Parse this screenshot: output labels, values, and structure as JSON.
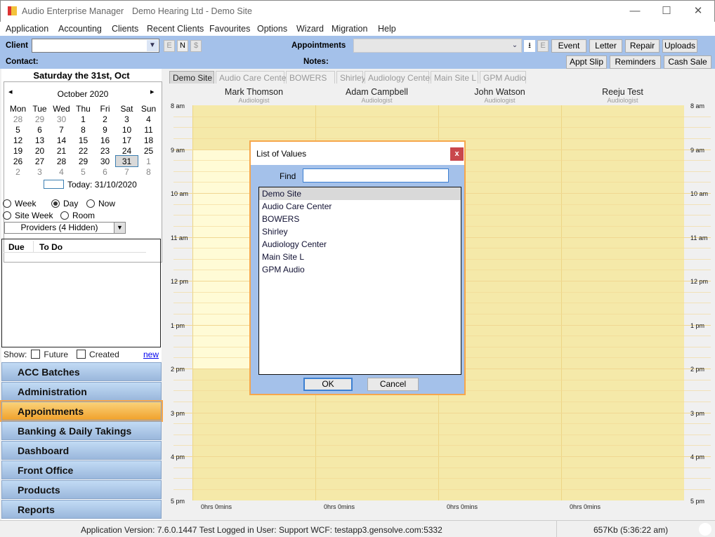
{
  "window": {
    "app_title": "Audio Enterprise Manager",
    "subtitle": "Demo Hearing Ltd - Demo Site",
    "minimize": "—",
    "maximize": "☐",
    "close": "✕"
  },
  "menu": [
    "Application",
    "Accounting",
    "Clients",
    "Recent Clients",
    "Favourites",
    "Options",
    "Wizard",
    "Migration",
    "Help"
  ],
  "toolbar": {
    "client_label": "Client",
    "client_value": "",
    "e": "E",
    "n": "N",
    "dollar": "$",
    "contact_label": "Contact:",
    "appointments_label": "Appointments",
    "notes_label": "Notes:",
    "download": "⭳",
    "e2": "E",
    "buttons_row1": [
      "Event",
      "Letter",
      "Repair",
      "Uploads"
    ],
    "buttons_row2": [
      "Appt Slip",
      "Reminders",
      "Cash Sale"
    ]
  },
  "calendar": {
    "heading": "Saturday the 31st, Oct",
    "month": "October 2020",
    "prev": "◂",
    "next": "▸",
    "weekdays": [
      "Mon",
      "Tue",
      "Wed",
      "Thu",
      "Fri",
      "Sat",
      "Sun"
    ],
    "weeks": [
      [
        "28",
        "29",
        "30",
        "1",
        "2",
        "3",
        "4"
      ],
      [
        "5",
        "6",
        "7",
        "8",
        "9",
        "10",
        "11"
      ],
      [
        "12",
        "13",
        "14",
        "15",
        "16",
        "17",
        "18"
      ],
      [
        "19",
        "20",
        "21",
        "22",
        "23",
        "24",
        "25"
      ],
      [
        "26",
        "27",
        "28",
        "29",
        "30",
        "31",
        "1"
      ],
      [
        "2",
        "3",
        "4",
        "5",
        "6",
        "7",
        "8"
      ]
    ],
    "selected": "31",
    "today": "Today: 31/10/2020"
  },
  "view": {
    "options": [
      "Week",
      "Day",
      "Now",
      "Site Week",
      "Room"
    ],
    "selected": "Day",
    "providers": "Providers (4 Hidden)"
  },
  "todo": {
    "columns": [
      "Due",
      "To Do"
    ],
    "show_label": "Show:",
    "future": "Future",
    "created": "Created",
    "new_link": "new"
  },
  "nav": {
    "items": [
      "ACC Batches",
      "Administration",
      "Appointments",
      "Banking & Daily Takings",
      "Dashboard",
      "Front Office",
      "Products",
      "Reports"
    ],
    "active": "Appointments"
  },
  "schedule": {
    "tabs": [
      "Demo Site",
      "Audio Care Center",
      "BOWERS",
      "Shirley",
      "Audiology Center",
      "Main Site L",
      "GPM Audio"
    ],
    "active_tab": "Demo Site",
    "providers": [
      {
        "name": "Mark Thomson",
        "role": "Audiologist",
        "total": "0hrs 0mins"
      },
      {
        "name": "Adam  Campbell",
        "role": "Audiologist",
        "total": "0hrs 0mins"
      },
      {
        "name": "John Watson",
        "role": "Audiologist",
        "total": "0hrs 0mins"
      },
      {
        "name": "Reeju Test",
        "role": "Audiologist",
        "total": "0hrs 0mins"
      }
    ],
    "hours": [
      "8 am",
      "9 am",
      "10 am",
      "11 am",
      "12 pm",
      "1 pm",
      "2 pm",
      "3 pm",
      "4 pm",
      "5 pm"
    ]
  },
  "dialog": {
    "title": "List of Values",
    "close": "x",
    "find_label": "Find",
    "find_value": "",
    "items": [
      "Demo Site",
      "Audio Care Center",
      "BOWERS",
      "Shirley",
      "Audiology Center",
      "Main Site L",
      "GPM Audio"
    ],
    "selected": "Demo Site",
    "ok": "OK",
    "cancel": "Cancel"
  },
  "status": {
    "info": "Application Version: 7.6.0.1447 Test  Logged in User: Support WCF: testapp3.gensolve.com:5332",
    "memory": "657Kb  (5:36:22 am)"
  },
  "colors": {
    "accent_blue": "#a4c1ea",
    "active_nav": "#f1a22c",
    "slot": "#f5e9a9",
    "working": "#fffbd6",
    "close_red": "#c9474c"
  }
}
